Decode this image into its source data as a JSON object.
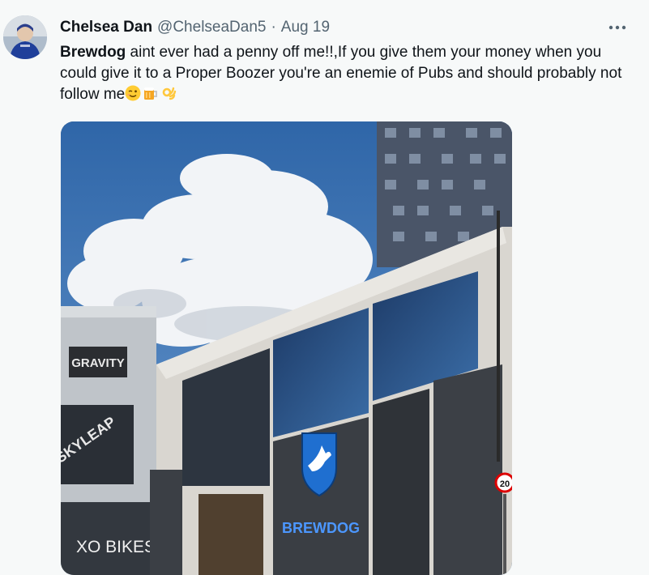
{
  "tweet": {
    "author_name": "Chelsea Dan",
    "handle": "@ChelseaDan5",
    "separator": "·",
    "date": "Aug 19",
    "mention": "Brewdog",
    "text": " aint ever had a penny off me!!,If you give them your money when you could give it to a Proper Boozer you're an enemie of Pubs and should probably not follow me",
    "emojis": [
      "winking-face-emoji",
      "beer-mug-emoji",
      "ok-hand-emoji"
    ]
  },
  "image": {
    "signs": {
      "gravity": "GRAVITY",
      "skyleap": "SKYLEAP",
      "xo_bikes": "XO BIKES",
      "brewdog": "BREWDOG",
      "speed_limit": "20"
    }
  },
  "colors": {
    "text_primary": "#0f1419",
    "text_secondary": "#536471",
    "background": "#f7f9f9",
    "sky": "#3f74b3",
    "brewdog_blue": "#1f6fd0"
  }
}
